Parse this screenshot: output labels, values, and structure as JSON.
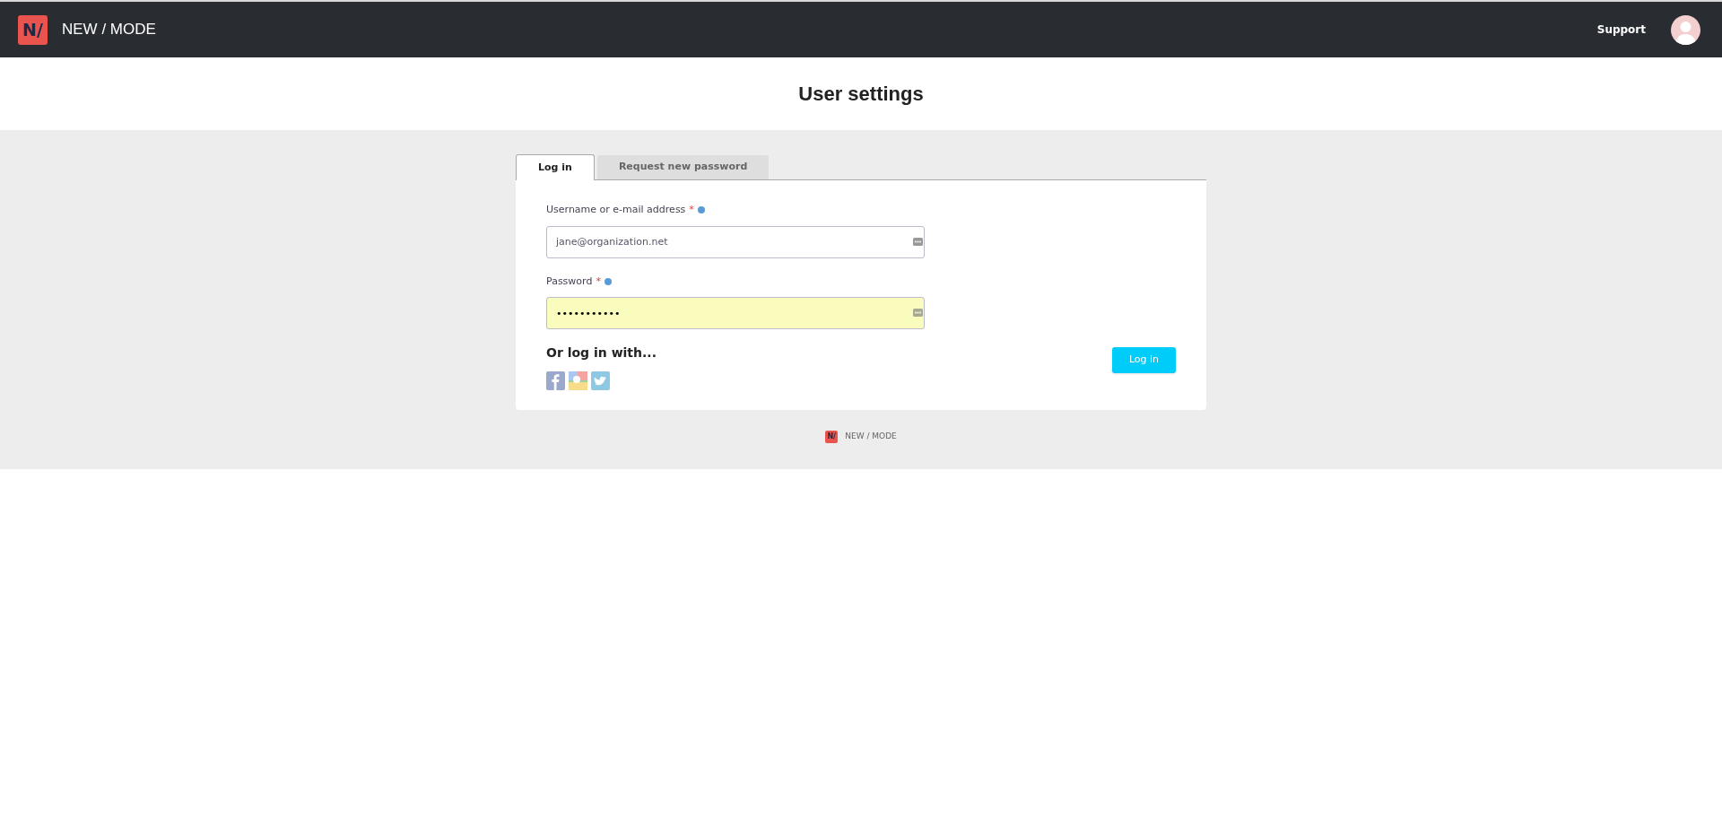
{
  "header": {
    "logo_text": "N/",
    "brand": "NEW / MODE",
    "support_link": "Support"
  },
  "page_title": "User settings",
  "tabs": [
    {
      "label": "Log in",
      "selected": true
    },
    {
      "label": "Request new password",
      "selected": false
    }
  ],
  "form": {
    "fields": [
      {
        "label": "Username or e-mail address",
        "required_mark": "*",
        "value": "jane@organization.net",
        "autofilled": false
      },
      {
        "label": "Password",
        "required_mark": "*",
        "value": "•••••••••••",
        "autofilled": true
      }
    ],
    "social_heading": "Or log in with...",
    "submit": "Log in"
  },
  "footer": {
    "logo_text": "N/",
    "brand": "NEW / MODE"
  }
}
